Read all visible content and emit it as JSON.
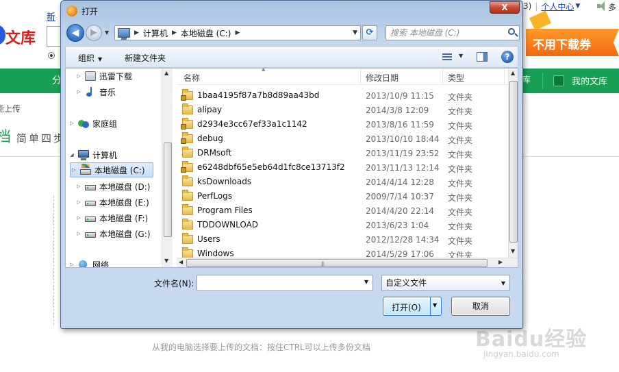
{
  "background": {
    "new_link": "新",
    "logo_text": "文库",
    "top_links": [
      "3)",
      "个人中心"
    ],
    "top_cut": "多",
    "ad_text": "不用下载券",
    "nav_left": "分",
    "nav_library": "库",
    "nav_my_library": "我的文库",
    "upload_label": "能上传",
    "tagline_char": "档",
    "tagline_rest": "简单四步",
    "hint": "从我的电脑选择要上传的文档：按住CTRL可以上传多份文档",
    "watermark": "Baidu经验",
    "watermark_sub": "jingyan.baidu.com"
  },
  "dialog": {
    "title": "打开",
    "close_label": "X",
    "address": {
      "crumbs": [
        "计算机",
        "本地磁盘 (C:)"
      ]
    },
    "search_placeholder": "搜索 本地磁盘 (C:)",
    "toolbar": {
      "organize": "组织",
      "new_folder": "新建文件夹"
    },
    "tree": [
      {
        "label": "迅雷下载",
        "icon": "xunlei-icon"
      },
      {
        "label": "音乐",
        "icon": "music-icon"
      },
      {
        "label": "家庭组",
        "icon": "homegroup-icon"
      },
      {
        "label": "计算机",
        "icon": "computer-icon"
      },
      {
        "label": "本地磁盘 (C:)",
        "icon": "drive-c-icon",
        "selected": true
      },
      {
        "label": "本地磁盘 (D:)",
        "icon": "drive-icon"
      },
      {
        "label": "本地磁盘 (E:)",
        "icon": "drive-icon"
      },
      {
        "label": "本地磁盘 (F:)",
        "icon": "drive-icon"
      },
      {
        "label": "本地磁盘 (G:)",
        "icon": "drive-icon"
      },
      {
        "label": "网络",
        "icon": "network-icon"
      }
    ],
    "columns": {
      "name": "名称",
      "modified": "修改日期",
      "type": "类型"
    },
    "files": [
      {
        "name": "1baa4195f87a7b8d89aa43bd",
        "date": "2013/10/9 11:15",
        "type": "文件夹",
        "locked": true
      },
      {
        "name": "alipay",
        "date": "2014/3/8 12:09",
        "type": "文件夹",
        "locked": false
      },
      {
        "name": "d2934e3cc67ef33a1c1142",
        "date": "2013/8/16 11:59",
        "type": "文件夹",
        "locked": true
      },
      {
        "name": "debug",
        "date": "2013/10/10 18:44",
        "type": "文件夹",
        "locked": true
      },
      {
        "name": "DRMsoft",
        "date": "2013/11/19 23:52",
        "type": "文件夹",
        "locked": false
      },
      {
        "name": "e6248dbf65e5eb64d1fc8ce13713f2",
        "date": "2013/11/13 12:14",
        "type": "文件夹",
        "locked": true
      },
      {
        "name": "ksDownloads",
        "date": "2014/4/14 12:28",
        "type": "文件夹",
        "locked": false
      },
      {
        "name": "PerfLogs",
        "date": "2009/7/14 10:37",
        "type": "文件夹",
        "locked": false
      },
      {
        "name": "Program Files",
        "date": "2014/4/20 22:14",
        "type": "文件夹",
        "locked": false
      },
      {
        "name": "TDDOWNLOAD",
        "date": "2013/6/23 1:04",
        "type": "文件夹",
        "locked": false
      },
      {
        "name": "Users",
        "date": "2012/12/28 14:34",
        "type": "文件夹",
        "locked": false
      },
      {
        "name": "Windows",
        "date": "2014/5/29 17:06",
        "type": "文件夹",
        "locked": false
      }
    ],
    "filename_label": "文件名(N):",
    "filename_value": "",
    "filter_value": "自定义文件",
    "open_label": "打开(O)",
    "cancel_label": "取消"
  }
}
